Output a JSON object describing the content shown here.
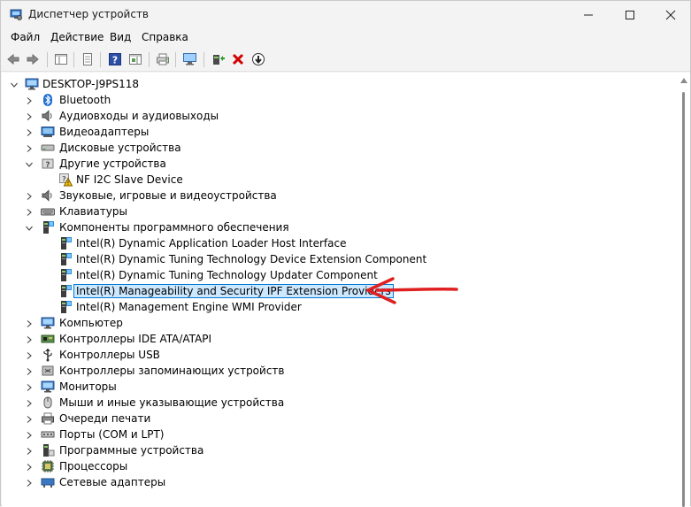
{
  "window": {
    "title": "Диспетчер устройств"
  },
  "menu": {
    "items": [
      "Файл",
      "Действие",
      "Вид",
      "Справка"
    ]
  },
  "tree": {
    "root": "DESKTOP-J9PS118",
    "rows": [
      {
        "level": 0,
        "expander": "expanded",
        "icon": "computer-icon",
        "label": "DESKTOP-J9PS118"
      },
      {
        "level": 1,
        "expander": "collapsed",
        "icon": "bluetooth-icon",
        "label": "Bluetooth"
      },
      {
        "level": 1,
        "expander": "collapsed",
        "icon": "speaker-icon",
        "label": "Аудиовходы и аудиовыходы"
      },
      {
        "level": 1,
        "expander": "collapsed",
        "icon": "display-adapter-icon",
        "label": "Видеоадаптеры"
      },
      {
        "level": 1,
        "expander": "collapsed",
        "icon": "disk-drive-icon",
        "label": "Дисковые устройства"
      },
      {
        "level": 1,
        "expander": "expanded",
        "icon": "unknown-device-icon",
        "label": "Другие устройства"
      },
      {
        "level": 2,
        "expander": "none",
        "icon": "warning-device-icon",
        "label": "NF I2C Slave Device"
      },
      {
        "level": 1,
        "expander": "collapsed",
        "icon": "speaker-icon",
        "label": "Звуковые, игровые и видеоустройства"
      },
      {
        "level": 1,
        "expander": "collapsed",
        "icon": "keyboard-icon",
        "label": "Клавиатуры"
      },
      {
        "level": 1,
        "expander": "expanded",
        "icon": "software-component-icon",
        "label": "Компоненты программного обеспечения"
      },
      {
        "level": 2,
        "expander": "none",
        "icon": "software-component-icon",
        "label": "Intel(R) Dynamic Application Loader Host Interface"
      },
      {
        "level": 2,
        "expander": "none",
        "icon": "software-component-icon",
        "label": "Intel(R) Dynamic Tuning Technology Device Extension Component"
      },
      {
        "level": 2,
        "expander": "none",
        "icon": "software-component-icon",
        "label": "Intel(R) Dynamic Tuning Technology Updater Component"
      },
      {
        "level": 2,
        "expander": "none",
        "icon": "software-component-icon",
        "label": "Intel(R) Manageability and Security IPF Extension Providers",
        "selected": true
      },
      {
        "level": 2,
        "expander": "none",
        "icon": "software-component-icon",
        "label": "Intel(R) Management Engine WMI Provider"
      },
      {
        "level": 1,
        "expander": "collapsed",
        "icon": "monitor-icon",
        "label": "Компьютер"
      },
      {
        "level": 1,
        "expander": "collapsed",
        "icon": "ide-controller-icon",
        "label": "Контроллеры IDE ATA/ATAPI"
      },
      {
        "level": 1,
        "expander": "collapsed",
        "icon": "usb-icon",
        "label": "Контроллеры USB"
      },
      {
        "level": 1,
        "expander": "collapsed",
        "icon": "storage-controller-icon",
        "label": "Контроллеры запоминающих устройств"
      },
      {
        "level": 1,
        "expander": "collapsed",
        "icon": "monitor-icon",
        "label": "Мониторы"
      },
      {
        "level": 1,
        "expander": "collapsed",
        "icon": "mouse-icon",
        "label": "Мыши и иные указывающие устройства"
      },
      {
        "level": 1,
        "expander": "collapsed",
        "icon": "printer-icon",
        "label": "Очереди печати"
      },
      {
        "level": 1,
        "expander": "collapsed",
        "icon": "port-icon",
        "label": "Порты (COM и LPT)"
      },
      {
        "level": 1,
        "expander": "collapsed",
        "icon": "software-device-icon",
        "label": "Программные устройства"
      },
      {
        "level": 1,
        "expander": "collapsed",
        "icon": "processor-icon",
        "label": "Процессоры"
      },
      {
        "level": 1,
        "expander": "collapsed",
        "icon": "network-adapter-icon",
        "label": "Сетевые адаптеры"
      }
    ]
  },
  "annotation": {
    "arrow_color": "#e02020"
  },
  "colors": {
    "selection_bg": "#cce8ff",
    "selection_border": "#0078d7",
    "remove_red": "#d40000",
    "help_blue": "#2b4fa8"
  }
}
